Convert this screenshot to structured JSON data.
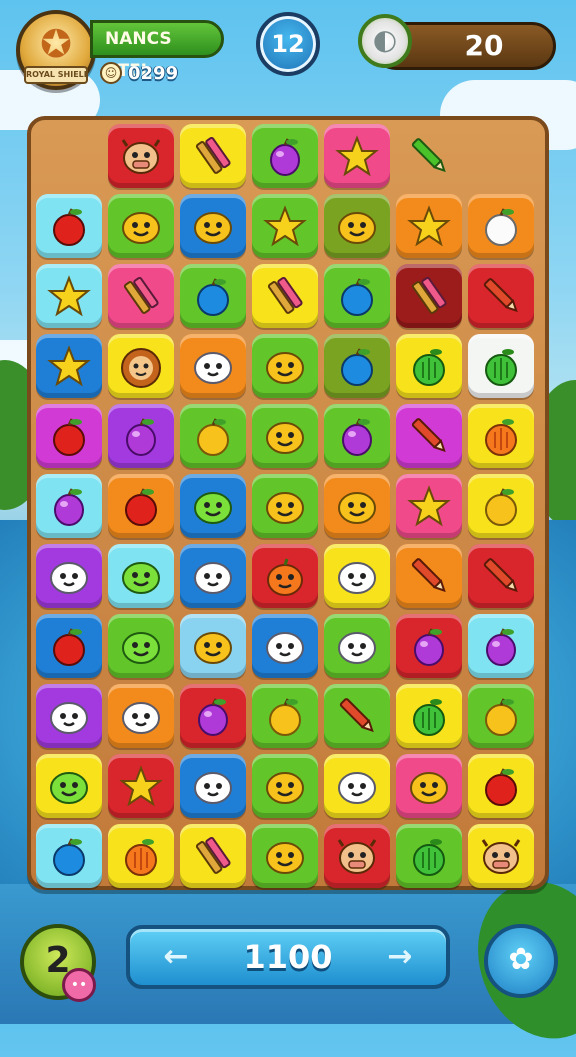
{
  "header": {
    "badge_text": "ROYAL SHIELD",
    "player_name": "NANCS CTEL",
    "coins": "0299",
    "level": "12",
    "score": "20"
  },
  "board": {
    "columns": 7,
    "rows": 11,
    "tiles": [
      [
        "empty",
        "red:cow",
        "yellow:pencils",
        "green:berry",
        "pink:star",
        "empty:pencil-green",
        null
      ],
      [
        "cyan:apple",
        "green:smiley",
        "blue:smiley",
        "green:star",
        "olive:smiley",
        "orange:star",
        "orange:apple-white"
      ],
      [
        "cyan:star",
        "pink:pencils",
        "green:apple-blue",
        "yellow:pencils",
        "green:apple-blue",
        "darkred:pencils",
        "red:pencil"
      ],
      [
        "blue:star",
        "yellow:lion",
        "orange:ghost",
        "green:smiley",
        "olive:apple-blue",
        "yellow:apple-green",
        "white:apple-green"
      ],
      [
        "magenta:apple",
        "purple:berry",
        "green:apple-yellow",
        "green:smiley",
        "green:berry",
        "magenta:pencil",
        "yellow:apple-orange"
      ],
      [
        "cyan:berry",
        "orange:apple",
        "blue:smiley-green",
        "green:smiley",
        "orange:smiley",
        "pink:star",
        "yellow:apple-yellow"
      ],
      [
        "purple:ghost",
        "cyan:smiley-green",
        "blue:ghost",
        "red:pumpkin",
        "yellow:ghost",
        "orange:pencil",
        "red:pencil"
      ],
      [
        "blue:apple",
        "green:smiley-green",
        "lightblue:smiley",
        "blue:ghost",
        "green:ghost",
        "red:berry",
        "cyan:berry"
      ],
      [
        "purple:ghost",
        "orange:ghost",
        "red:berry",
        "green:apple-yellow",
        "green:pencil",
        "yellow:apple-green",
        "green:apple-yellow"
      ],
      [
        "yellow:smiley-green",
        "red:star",
        "blue:ghost",
        "green:smiley",
        "yellow:ghost",
        "pink:smiley",
        "yellow:apple"
      ],
      [
        "cyan:apple-blue",
        "yellow:apple-orange",
        "yellow:pencils",
        "green:smiley",
        "red:cow",
        "green:apple-green",
        "yellow:cow"
      ]
    ]
  },
  "footer": {
    "moves": "2",
    "left_arrow": "←",
    "value": "1100",
    "right_arrow": "→"
  },
  "colors": {
    "red": "#d8262c",
    "darkred": "#9c1b1b",
    "yellow": "#f7e21c",
    "green": "#62c52a",
    "olive": "#7aa321",
    "pink": "#f04a8a",
    "cyan": "#7fe3f2",
    "blue": "#1f7fd6",
    "lightblue": "#8ad3f0",
    "orange": "#f38b1c",
    "magenta": "#d23ad6",
    "purple": "#a23ae0",
    "white": "#f4f6f4",
    "empty": "transparent"
  }
}
